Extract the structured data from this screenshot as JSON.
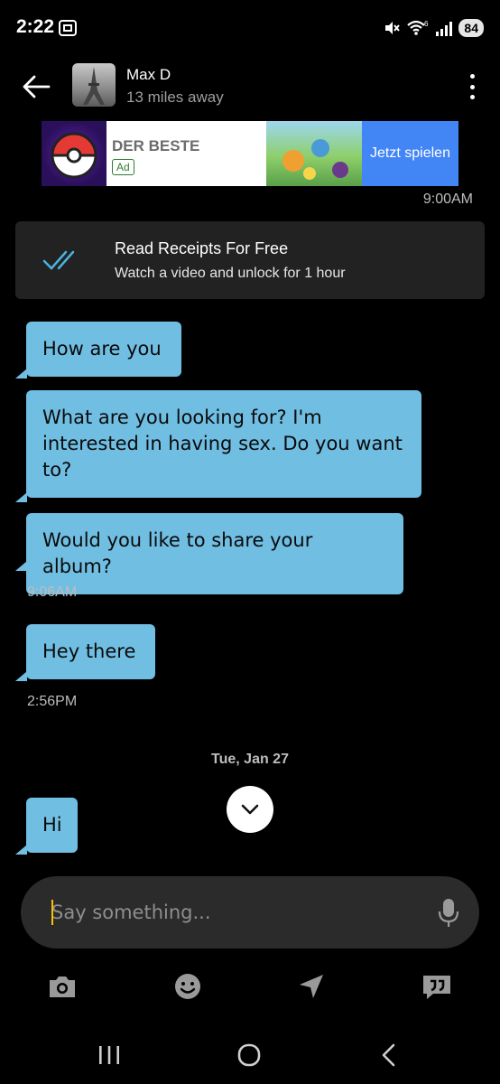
{
  "status": {
    "time": "2:22",
    "battery": "84",
    "network": "6"
  },
  "header": {
    "name": "Max D",
    "distance": "13 miles away"
  },
  "ad": {
    "headline": "DER BESTE",
    "badge": "Ad",
    "cta": "Jetzt spielen",
    "time": "9:00AM"
  },
  "receipts": {
    "title": "Read Receipts For Free",
    "subtitle": "Watch a video and unlock for 1 hour"
  },
  "messages": [
    {
      "text": "How are you"
    },
    {
      "text": "What are you looking for? I'm interested in having sex. Do you want to?"
    },
    {
      "text": "Would you like to share your album?"
    },
    {
      "text": "Hey there"
    },
    {
      "text": "Hi"
    }
  ],
  "times": [
    "9:06AM",
    "2:56PM"
  ],
  "date_divider": "Tue, Jan 27",
  "composer": {
    "placeholder": "Say something..."
  },
  "colors": {
    "bubble": "#71bee3",
    "accent_blue": "#4285f4",
    "caret": "#f6c300",
    "card": "#222222"
  }
}
